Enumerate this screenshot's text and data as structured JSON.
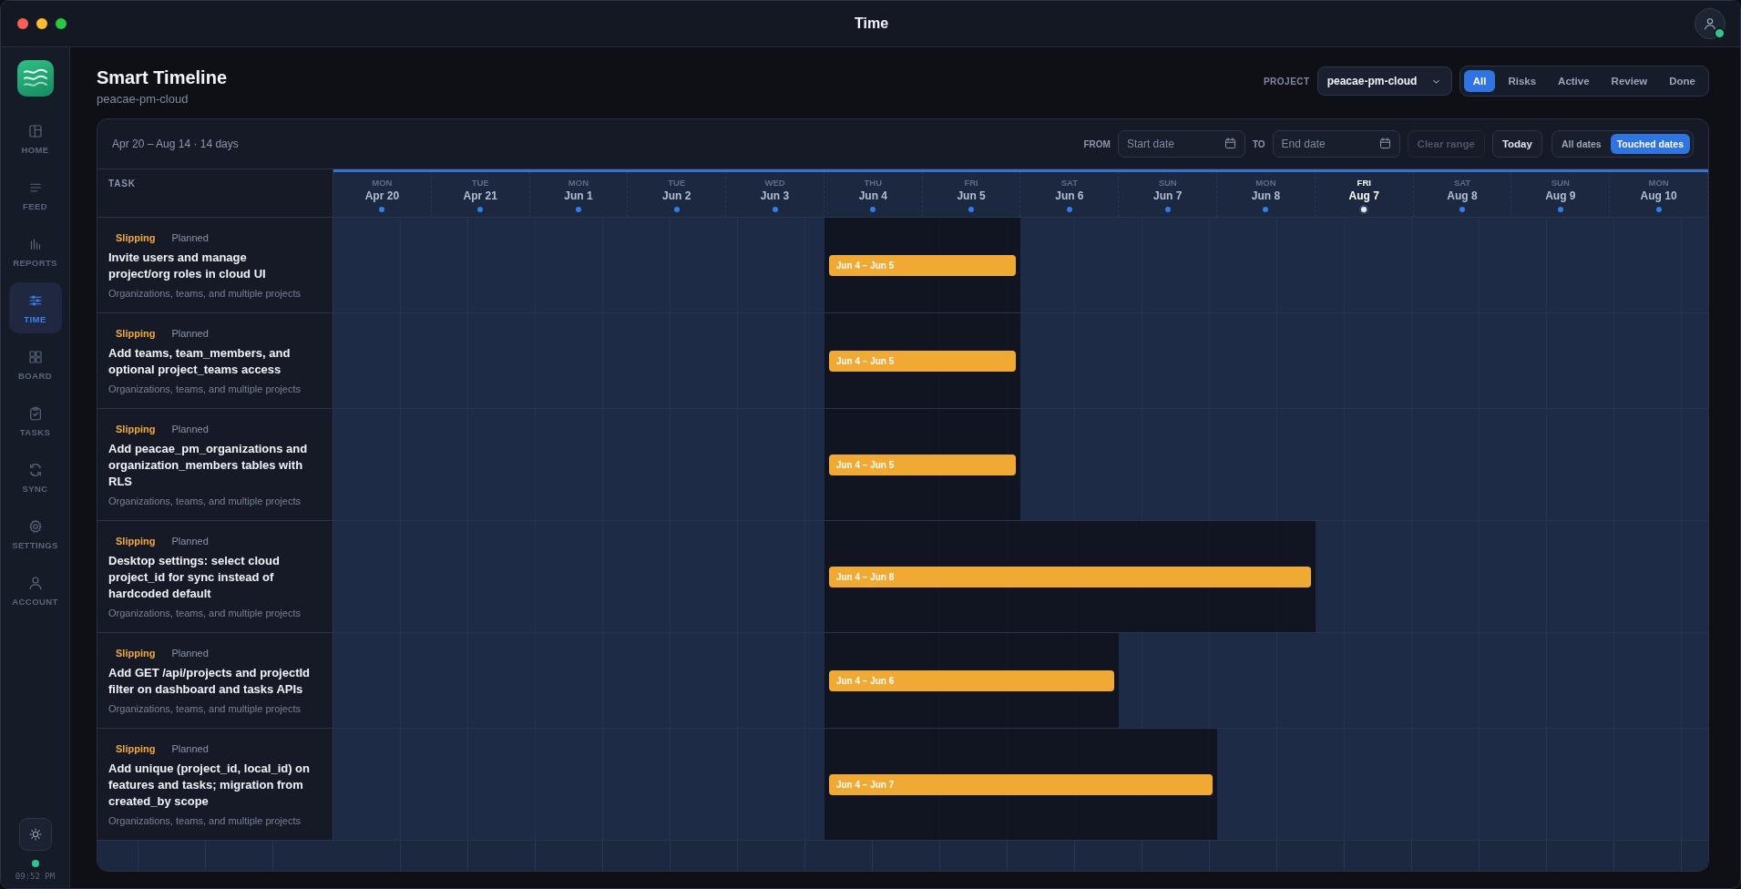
{
  "window": {
    "title": "Time"
  },
  "sidebar": {
    "items": [
      {
        "label": "HOME",
        "selected": false
      },
      {
        "label": "FEED",
        "selected": false
      },
      {
        "label": "REPORTS",
        "selected": false
      },
      {
        "label": "TIME",
        "selected": true
      },
      {
        "label": "BOARD",
        "selected": false
      },
      {
        "label": "TASKS",
        "selected": false
      },
      {
        "label": "SYNC",
        "selected": false
      },
      {
        "label": "SETTINGS",
        "selected": false
      },
      {
        "label": "ACCOUNT",
        "selected": false
      }
    ],
    "clock": "09:52 PM"
  },
  "header": {
    "title": "Smart Timeline",
    "subtitle": "peacae-pm-cloud",
    "project_label": "PROJECT",
    "project": "peacae-pm-cloud",
    "filters": [
      {
        "label": "All",
        "selected": true
      },
      {
        "label": "Risks",
        "selected": false
      },
      {
        "label": "Active",
        "selected": false
      },
      {
        "label": "Review",
        "selected": false
      },
      {
        "label": "Done",
        "selected": false
      }
    ]
  },
  "toolbar": {
    "range": "Apr 20 – Aug 14 · 14 days",
    "from_label": "FROM",
    "from": {
      "placeholder": "Start date"
    },
    "to_label": "TO",
    "to": {
      "placeholder": "End date"
    },
    "clear": {
      "label": "Clear range",
      "disabled": true
    },
    "today": {
      "label": "Today",
      "disabled": false
    },
    "modes": [
      {
        "label": "All dates",
        "selected": false
      },
      {
        "label": "Touched dates",
        "selected": true
      }
    ]
  },
  "table": {
    "task_column": "TASK",
    "days": [
      {
        "weekday": "MON",
        "date": "Apr 20",
        "today": false
      },
      {
        "weekday": "TUE",
        "date": "Apr 21",
        "today": false
      },
      {
        "weekday": "MON",
        "date": "Jun 1",
        "today": false
      },
      {
        "weekday": "TUE",
        "date": "Jun 2",
        "today": false
      },
      {
        "weekday": "WED",
        "date": "Jun 3",
        "today": false
      },
      {
        "weekday": "THU",
        "date": "Jun 4",
        "today": false
      },
      {
        "weekday": "FRI",
        "date": "Jun 5",
        "today": false
      },
      {
        "weekday": "SAT",
        "date": "Jun 6",
        "today": false
      },
      {
        "weekday": "SUN",
        "date": "Jun 7",
        "today": false
      },
      {
        "weekday": "MON",
        "date": "Jun 8",
        "today": false
      },
      {
        "weekday": "FRI",
        "date": "Aug 7",
        "today": true
      },
      {
        "weekday": "SAT",
        "date": "Aug 8",
        "today": false
      },
      {
        "weekday": "SUN",
        "date": "Aug 9",
        "today": false
      },
      {
        "weekday": "MON",
        "date": "Aug 10",
        "today": false
      }
    ],
    "rows": [
      {
        "status": "Slipping",
        "phase": "Planned",
        "title": "Invite users and manage project/org roles in cloud UI",
        "subtitle": "Organizations, teams, and multiple projects",
        "bar": "Jun 4 – Jun 5",
        "span": [
          false,
          false,
          false,
          false,
          false,
          true,
          true,
          false,
          false,
          false,
          false,
          false,
          false,
          false
        ]
      },
      {
        "status": "Slipping",
        "phase": "Planned",
        "title": "Add teams, team_members, and optional project_teams access",
        "subtitle": "Organizations, teams, and multiple projects",
        "bar": "Jun 4 – Jun 5",
        "span": [
          false,
          false,
          false,
          false,
          false,
          true,
          true,
          false,
          false,
          false,
          false,
          false,
          false,
          false
        ]
      },
      {
        "status": "Slipping",
        "phase": "Planned",
        "title": "Add peacae_pm_organizations and organization_members tables with RLS",
        "subtitle": "Organizations, teams, and multiple projects",
        "bar": "Jun 4 – Jun 5",
        "span": [
          false,
          false,
          false,
          false,
          false,
          true,
          true,
          false,
          false,
          false,
          false,
          false,
          false,
          false
        ]
      },
      {
        "status": "Slipping",
        "phase": "Planned",
        "title": "Desktop settings: select cloud project_id for sync instead of hardcoded default",
        "subtitle": "Organizations, teams, and multiple projects",
        "bar": "Jun 4 – Jun 8",
        "span": [
          false,
          false,
          false,
          false,
          false,
          true,
          true,
          true,
          true,
          true,
          false,
          false,
          false,
          false
        ]
      },
      {
        "status": "Slipping",
        "phase": "Planned",
        "title": "Add GET /api/projects and projectId filter on dashboard and tasks APIs",
        "subtitle": "Organizations, teams, and multiple projects",
        "bar": "Jun 4 – Jun 6",
        "span": [
          false,
          false,
          false,
          false,
          false,
          true,
          true,
          true,
          false,
          false,
          false,
          false,
          false,
          false
        ]
      },
      {
        "status": "Slipping",
        "phase": "Planned",
        "title": "Add unique (project_id, local_id) on features and tasks; migration from created_by scope",
        "subtitle": "Organizations, teams, and multiple projects",
        "bar": "Jun 4 – Jun 7",
        "span": [
          false,
          false,
          false,
          false,
          false,
          true,
          true,
          true,
          true,
          false,
          false,
          false,
          false,
          false
        ]
      }
    ]
  }
}
